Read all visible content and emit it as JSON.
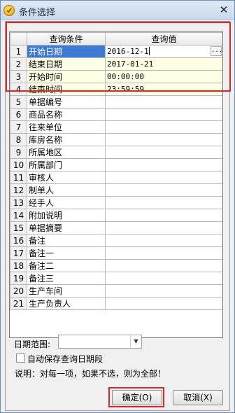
{
  "window": {
    "title": "条件选择",
    "close_symbol": "✕"
  },
  "grid": {
    "headers": [
      "查询条件",
      "查询值"
    ],
    "rows": [
      {
        "num": "1",
        "condition": "开始日期",
        "value": "2016-12-1"
      },
      {
        "num": "2",
        "condition": "结束日期",
        "value": "2017-01-21"
      },
      {
        "num": "3",
        "condition": "开始时间",
        "value": "00:00:00"
      },
      {
        "num": "4",
        "condition": "结束时间",
        "value": "23:59:59"
      },
      {
        "num": "5",
        "condition": "单据编号",
        "value": ""
      },
      {
        "num": "6",
        "condition": "商品名称",
        "value": ""
      },
      {
        "num": "7",
        "condition": "往来单位",
        "value": ""
      },
      {
        "num": "8",
        "condition": "库房名称",
        "value": ""
      },
      {
        "num": "9",
        "condition": "所属地区",
        "value": ""
      },
      {
        "num": "10",
        "condition": "所属部门",
        "value": ""
      },
      {
        "num": "11",
        "condition": "审核人",
        "value": ""
      },
      {
        "num": "12",
        "condition": "制单人",
        "value": ""
      },
      {
        "num": "13",
        "condition": "经手人",
        "value": ""
      },
      {
        "num": "14",
        "condition": "附加说明",
        "value": ""
      },
      {
        "num": "15",
        "condition": "单据摘要",
        "value": ""
      },
      {
        "num": "16",
        "condition": "备注",
        "value": ""
      },
      {
        "num": "17",
        "condition": "备注一",
        "value": ""
      },
      {
        "num": "18",
        "condition": "备注二",
        "value": ""
      },
      {
        "num": "19",
        "condition": "备注三",
        "value": ""
      },
      {
        "num": "20",
        "condition": "生产车间",
        "value": ""
      },
      {
        "num": "21",
        "condition": "生产负责人",
        "value": ""
      }
    ],
    "ellipsis": "..."
  },
  "date_range": {
    "label": "日期范围:",
    "value": "",
    "arrow": "▼"
  },
  "auto_save": {
    "label": "自动保存查询日期段",
    "checked": false
  },
  "note": "说明：对每一项，如果不选，则为全部！",
  "buttons": {
    "ok": "确定(O)",
    "cancel": "取消(X)"
  },
  "colors": {
    "selection": "#3d7ad6",
    "highlight_box": "#e02525",
    "row_highlight": "#ffffe6"
  }
}
